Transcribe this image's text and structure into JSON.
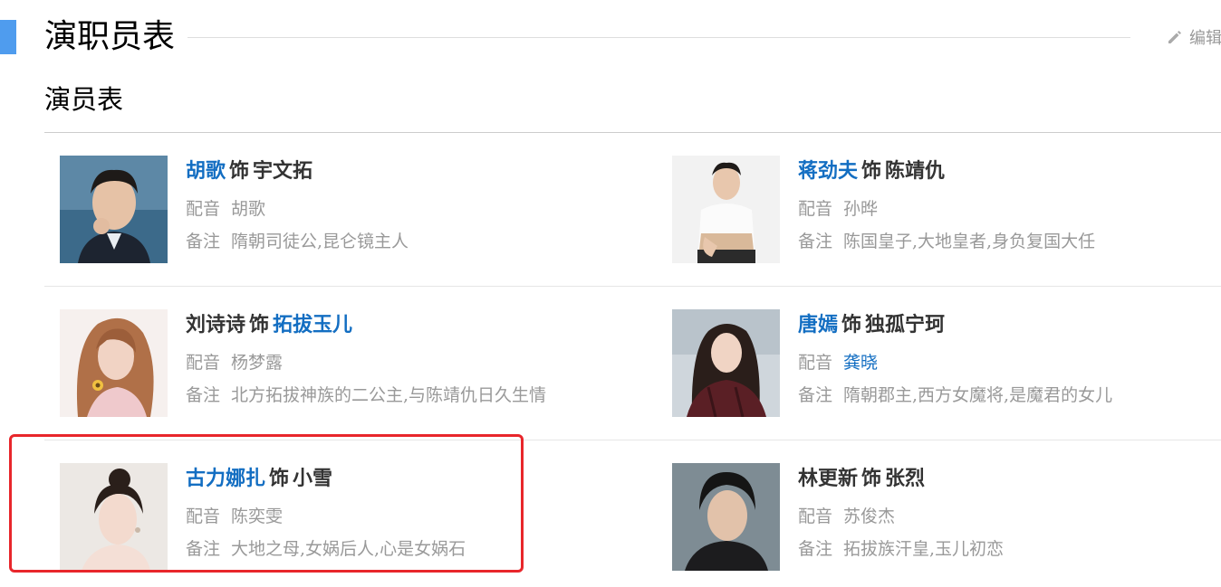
{
  "header": {
    "title": "演职员表",
    "edit_label": "编辑"
  },
  "section": {
    "title": "演员表"
  },
  "cast": [
    {
      "actor": "胡歌",
      "shi": "饰",
      "role": "宇文拓",
      "dub_label": "配音",
      "dub": "胡歌",
      "note_label": "备注",
      "note": "隋朝司徒公,昆仑镜主人"
    },
    {
      "actor": "蒋劲夫",
      "shi": "饰",
      "role": "陈靖仇",
      "dub_label": "配音",
      "dub": "孙晔",
      "note_label": "备注",
      "note": "陈国皇子,大地皇者,身负复国大任"
    },
    {
      "actor": "刘诗诗",
      "shi": "饰",
      "role": "拓拔玉儿",
      "dub_label": "配音",
      "dub": "杨梦露",
      "note_label": "备注",
      "note": "北方拓拔神族的二公主,与陈靖仇日久生情"
    },
    {
      "actor": "唐嫣",
      "shi": "饰",
      "role": "独孤宁珂",
      "dub_label": "配音",
      "dub": "龚晓",
      "note_label": "备注",
      "note": "隋朝郡主,西方女魔将,是魔君的女儿"
    },
    {
      "actor": "古力娜扎",
      "shi": "饰",
      "role": "小雪",
      "dub_label": "配音",
      "dub": "陈奕雯",
      "note_label": "备注",
      "note": "大地之母,女娲后人,心是女娲石"
    },
    {
      "actor": "林更新",
      "shi": "饰",
      "role": "张烈",
      "dub_label": "配音",
      "dub": "苏俊杰",
      "note_label": "备注",
      "note": "拓拔族汗皇,玉儿初恋"
    }
  ],
  "colors": {
    "accent": "#4f9cee",
    "link": "#136ec2",
    "highlight": "#e8262b"
  }
}
